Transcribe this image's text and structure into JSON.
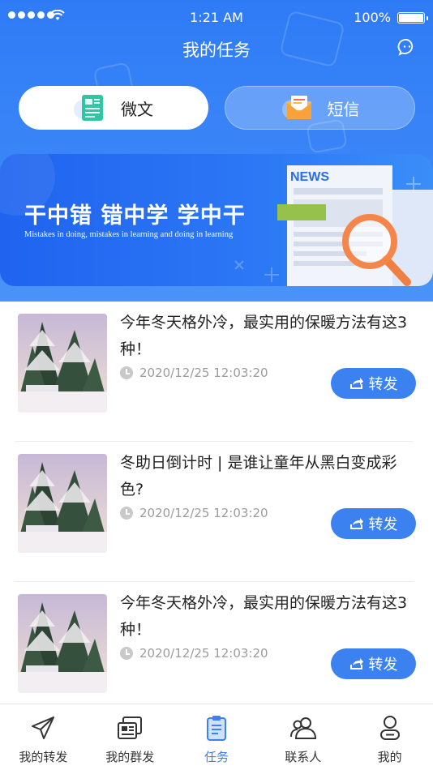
{
  "status_bar": {
    "time": "1:21 AM",
    "battery": "100%"
  },
  "header": {
    "title": "我的任务",
    "tabs": [
      {
        "label": "微文",
        "icon": "document-icon",
        "active": true
      },
      {
        "label": "短信",
        "icon": "envelope-icon",
        "active": false
      }
    ]
  },
  "banner": {
    "headline": "干中错 错中学 学中干",
    "subline": "Mistakes in doing, mistakes in learning and doing in learning",
    "news_label": "NEWS"
  },
  "articles": [
    {
      "title": "今年冬天格外冷，最实用的保暖方法有这3种！",
      "time": "2020/12/25 12:03:20",
      "action": "转发"
    },
    {
      "title": "冬助日倒计时 | 是谁让童年从黑白变成彩色?",
      "time": "2020/12/25 12:03:20",
      "action": "转发"
    },
    {
      "title": "今年冬天格外冷，最实用的保暖方法有这3种！",
      "time": "2020/12/25 12:03:20",
      "action": "转发"
    }
  ],
  "tabbar": {
    "items": [
      {
        "label": "我的转发",
        "icon": "paper-plane-icon"
      },
      {
        "label": "我的群发",
        "icon": "newspaper-icon"
      },
      {
        "label": "任务",
        "icon": "clipboard-icon"
      },
      {
        "label": "联系人",
        "icon": "contacts-icon"
      },
      {
        "label": "我的",
        "icon": "profile-icon"
      }
    ],
    "active_index": 2
  },
  "colors": {
    "primary": "#3b82f0",
    "header": "#2f7bf6",
    "text": "#222222",
    "muted": "#9c9c9c"
  }
}
